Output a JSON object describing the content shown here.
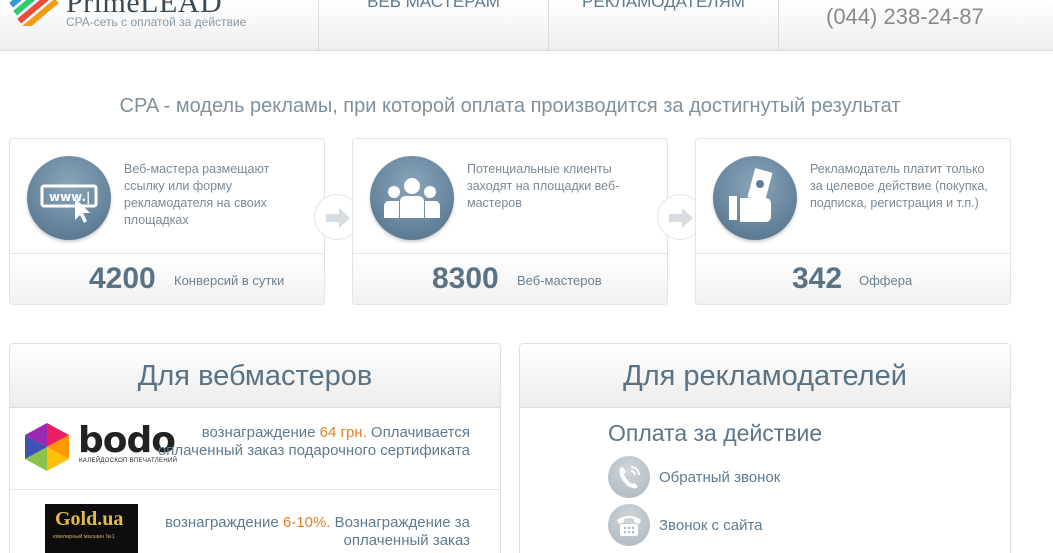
{
  "header": {
    "brand_name": "PrimeLEAD",
    "brand_tagline": "CPA-сеть с оплатой за действие",
    "nav": [
      {
        "label": "ВЕБ МАСТЕРАМ"
      },
      {
        "label": "РЕКЛАМОДАТЕЛЯМ"
      }
    ],
    "phone": "(044) 238-24-87"
  },
  "tagline": "CPA - модель рекламы, при которой оплата производится за достигнутый результат",
  "steps": [
    {
      "icon": "www-cursor-icon",
      "text": "Веб-мастера размещают ссылку или форму рекламодателя на своих площадках",
      "stat_value": "4200",
      "stat_label": "Конверсий в сутки"
    },
    {
      "icon": "people-group-icon",
      "text": "Потенциальные клиенты заходят на площадки веб-мастеров",
      "stat_value": "8300",
      "stat_label": "Веб-мастеров"
    },
    {
      "icon": "money-hand-icon",
      "text": "Рекламодатель платит только за целевое действие (покупка, подписка, регистрация и т.п.)",
      "stat_value": "342",
      "stat_label": "Оффера"
    }
  ],
  "webmasters": {
    "title": "Для вебмастеров",
    "offers": [
      {
        "logo_text": "bodo",
        "logo_subtext": "КАЛЕЙДОСКОП ВПЕЧАТЛЕНИЙ",
        "prefix": "вознаграждение ",
        "highlight": "64 грн.",
        "suffix": " Оплачивается оплаченный заказ подарочного сертификата"
      },
      {
        "logo_text": "Gold.ua",
        "logo_subtext": "ювелирный магазин №1",
        "prefix": "вознаграждение ",
        "highlight": "6-10%.",
        "suffix": " Вознаграждение за оплаченный заказ"
      }
    ]
  },
  "advertisers": {
    "title": "Для рекламодателей",
    "subtitle": "Оплата за действие",
    "items": [
      {
        "icon": "callback-phone-icon",
        "label": "Обратный звонок"
      },
      {
        "icon": "desk-phone-icon",
        "label": "Звонок с сайта"
      }
    ]
  },
  "colors": {
    "accent": "#e67e22",
    "heading": "#5a7284",
    "icon_bg": "#5f7f97"
  }
}
